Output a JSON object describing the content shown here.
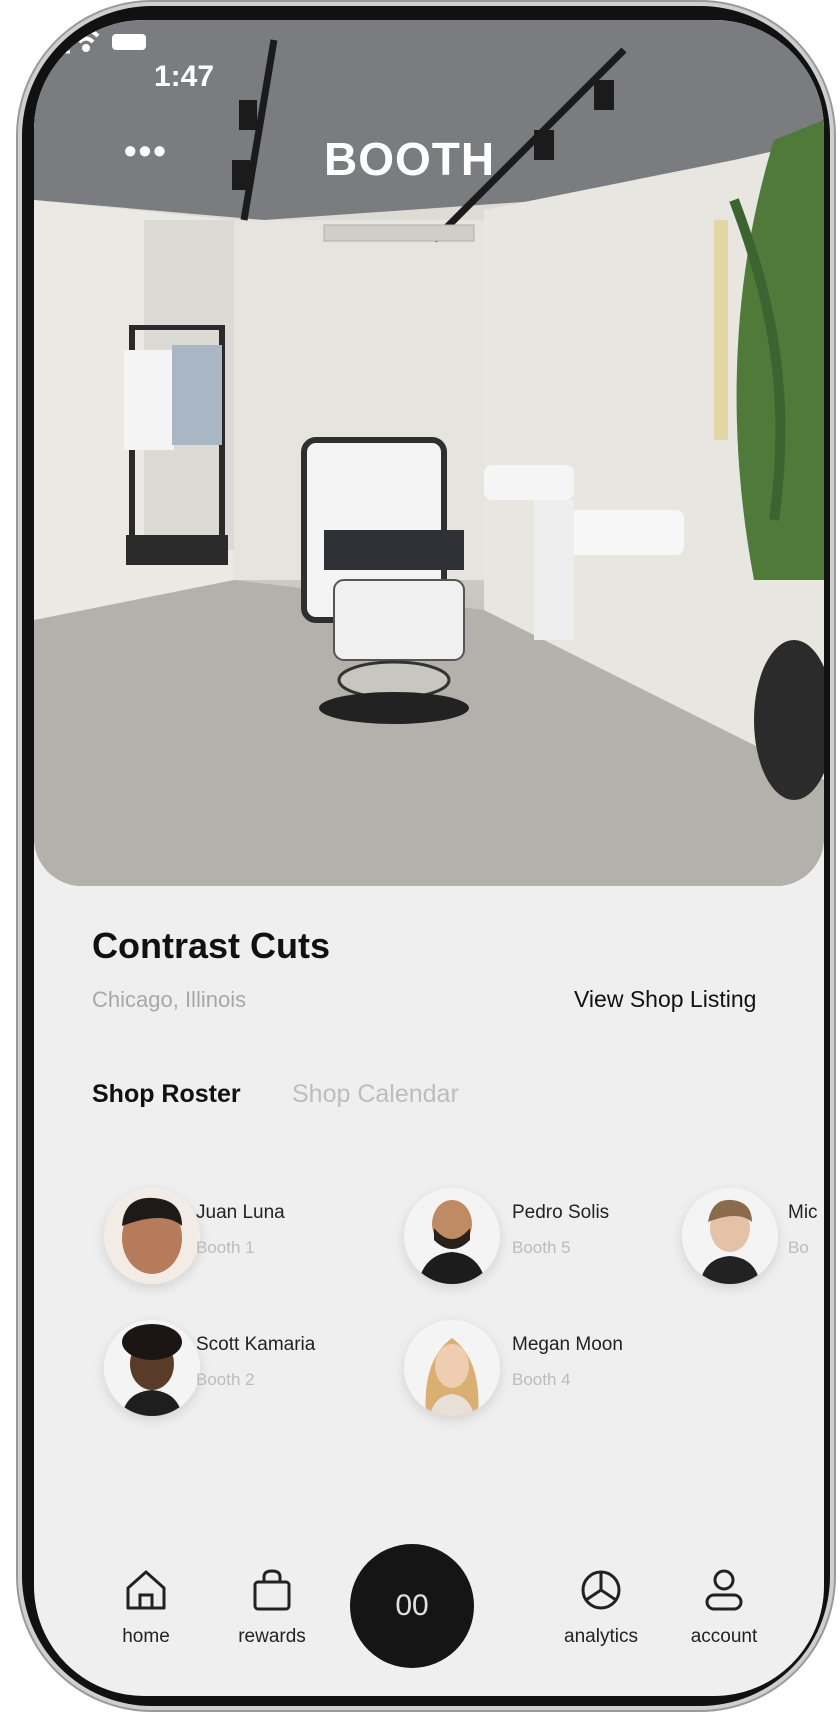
{
  "status": {
    "time": "1:47"
  },
  "header": {
    "title": "BOOTH",
    "menu": "•••"
  },
  "shop": {
    "name": "Contrast Cuts",
    "location": "Chicago, Illinois",
    "view_listing": "View Shop Listing"
  },
  "tabs": [
    {
      "label": "Shop Roster",
      "active": true
    },
    {
      "label": "Shop Calendar",
      "active": false
    }
  ],
  "roster": [
    {
      "name": "Juan Luna",
      "booth": "Booth 1"
    },
    {
      "name": "Pedro Solis",
      "booth": "Booth 5"
    },
    {
      "name": "Mic",
      "booth": "Bo"
    },
    {
      "name": "Scott Kamaria",
      "booth": "Booth 2"
    },
    {
      "name": "Megan Moon",
      "booth": "Booth 4"
    }
  ],
  "nav": {
    "home": "home",
    "rewards": "rewards",
    "center": "00",
    "analytics": "analytics",
    "account": "account"
  },
  "colors": {
    "accent_dark": "#151515",
    "notification": "#d0021b",
    "muted_text": "#a8a8a8"
  }
}
